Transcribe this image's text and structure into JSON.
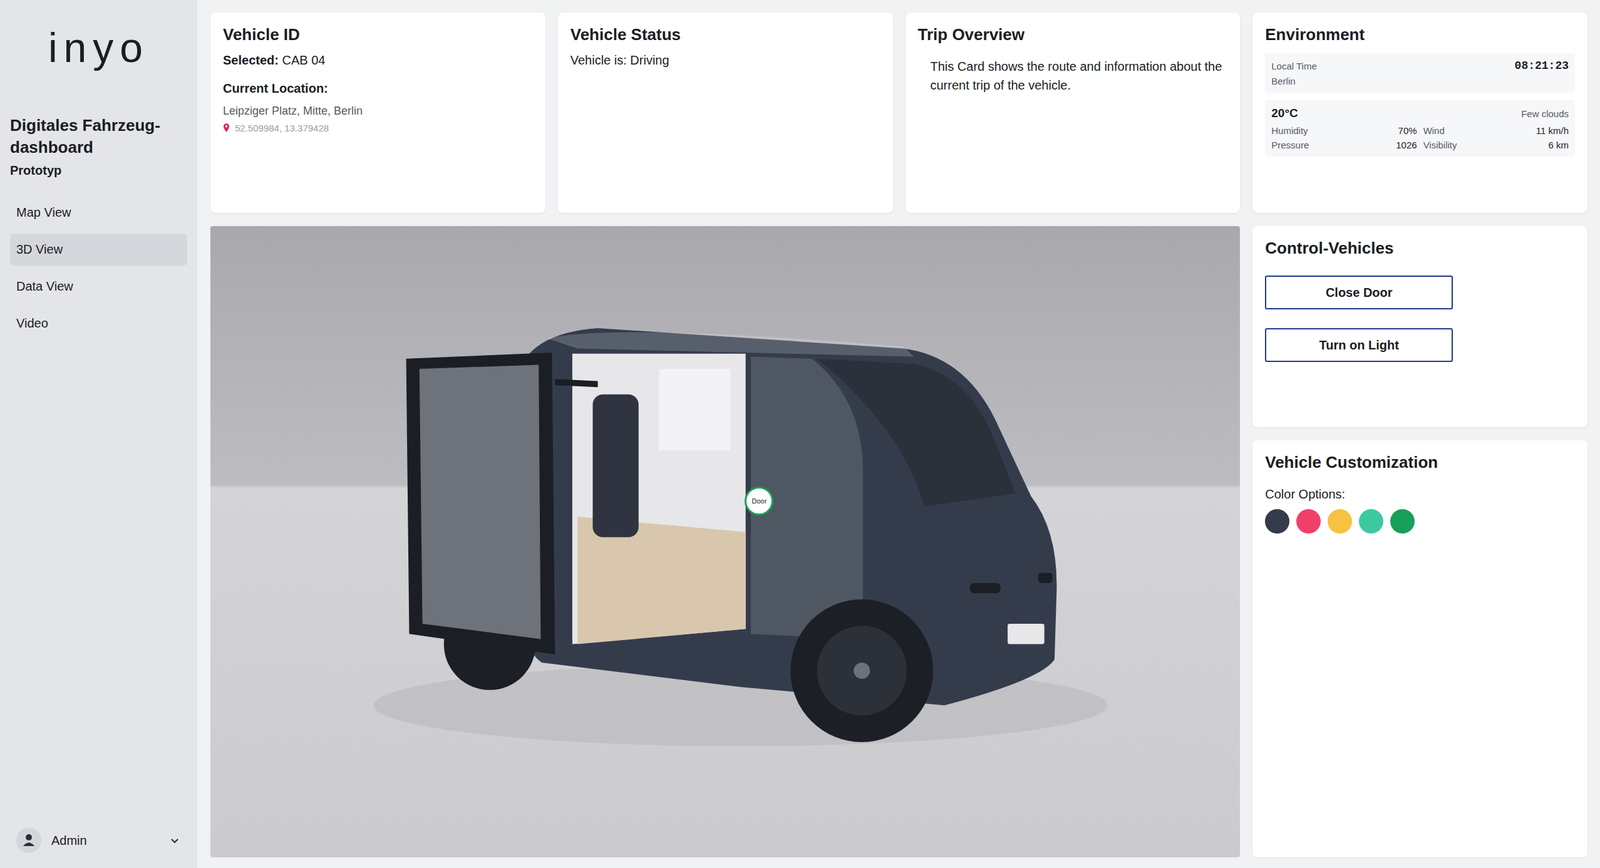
{
  "sidebar": {
    "logo": "inyo",
    "title": "Digitales Fahrzeug-dashboard",
    "subtitle": "Prototyp",
    "items": [
      {
        "label": "Map View",
        "selected": false
      },
      {
        "label": "3D View",
        "selected": true
      },
      {
        "label": "Data View",
        "selected": false
      },
      {
        "label": "Video",
        "selected": false
      }
    ],
    "user": {
      "name": "Admin"
    }
  },
  "vehicle_id": {
    "title": "Vehicle ID",
    "selected_label": "Selected:",
    "selected_value": "CAB 04",
    "location_label": "Current Location:",
    "address": "Leipziger Platz, Mitte, Berlin",
    "coordinates": "52.509984, 13.379428"
  },
  "vehicle_status": {
    "title": "Vehicle Status",
    "text": "Vehicle is: Driving"
  },
  "trip_overview": {
    "title": "Trip Overview",
    "text": "This Card shows the route and information about the current trip of the vehicle."
  },
  "environment": {
    "title": "Environment",
    "time_label": "Local Time",
    "time": "08:21:23",
    "city": "Berlin",
    "temperature": "20°C",
    "condition": "Few clouds",
    "stats": [
      {
        "label": "Humidity",
        "value": "70%"
      },
      {
        "label": "Wind",
        "value": "11 km/h"
      },
      {
        "label": "Pressure",
        "value": "1026"
      },
      {
        "label": "Visibility",
        "value": "6 km"
      }
    ]
  },
  "viewer": {
    "door_open": true,
    "hotspots": [
      {
        "label": "Door"
      }
    ]
  },
  "controls": {
    "title": "Control-Vehicles",
    "buttons": [
      "Close Door",
      "Turn on Light"
    ]
  },
  "customization": {
    "title": "Vehicle Customization",
    "label": "Color Options:",
    "colors": [
      {
        "color": "#343c4c",
        "selected": true
      },
      {
        "color": "#f0406a",
        "selected": false
      },
      {
        "color": "#f5c242",
        "selected": false
      },
      {
        "color": "#3cc9a0",
        "selected": false
      },
      {
        "color": "#16a05a",
        "selected": false
      }
    ]
  }
}
